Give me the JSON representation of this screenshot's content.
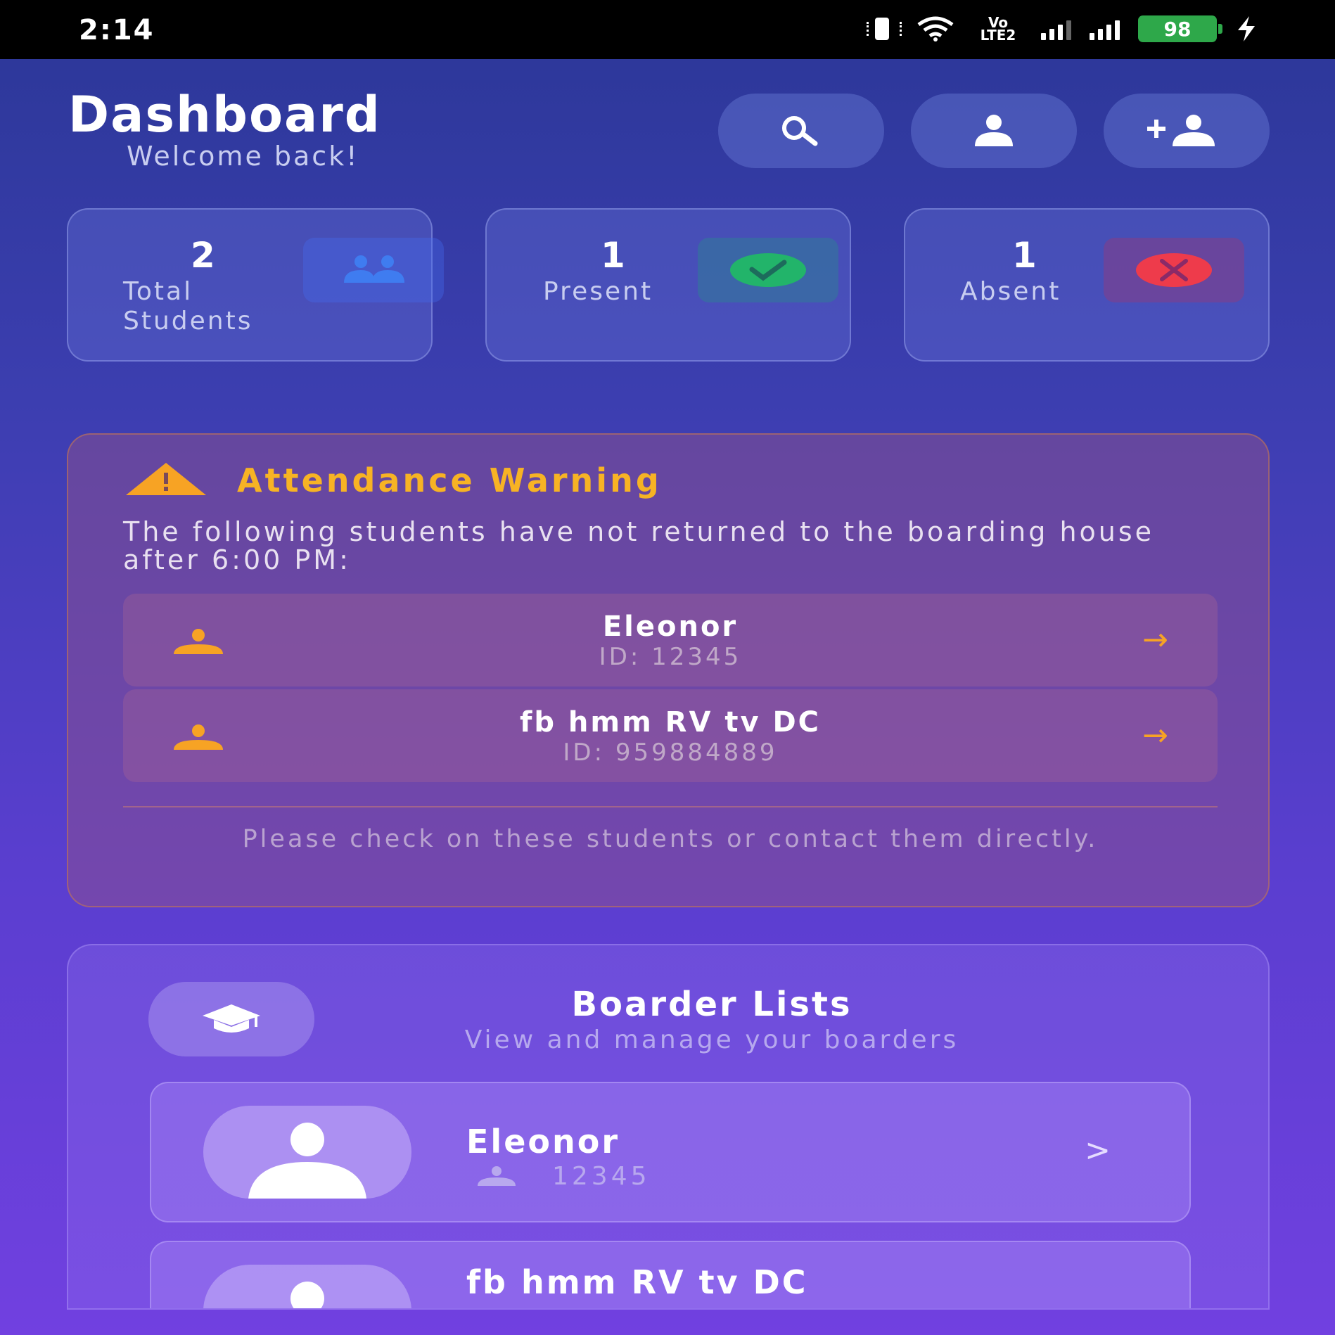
{
  "status_bar": {
    "time": "2:14",
    "network": "Vo LTE2",
    "battery": "98"
  },
  "header": {
    "title": "Dashboard",
    "subtitle": "Welcome back!",
    "icons": [
      "search-icon",
      "profile-icon",
      "add-user-icon"
    ]
  },
  "stats": [
    {
      "value": "2",
      "label": "Total Students",
      "icon": "users-icon",
      "color": "#3f7cf0"
    },
    {
      "value": "1",
      "label": "Present",
      "icon": "check-icon",
      "color": "#22b46a"
    },
    {
      "value": "1",
      "label": "Absent",
      "icon": "close-icon",
      "color": "#ee3b4b"
    }
  ],
  "warning": {
    "title": "Attendance Warning",
    "description": "The following students have not returned to the boarding house after 6:00 PM:",
    "students": [
      {
        "name": "Eleonor",
        "id": "ID: 12345"
      },
      {
        "name": "fb hmm RV tv DC",
        "id": "ID: 959884889"
      }
    ],
    "footer": "Please check on these students or contact them directly.",
    "color": "#f7b324"
  },
  "boarders": {
    "title": "Boarder Lists",
    "subtitle": "View and manage your boarders",
    "items": [
      {
        "name": "Eleonor",
        "id": "12345"
      },
      {
        "name": "fb hmm RV tv DC",
        "id": ""
      }
    ]
  }
}
